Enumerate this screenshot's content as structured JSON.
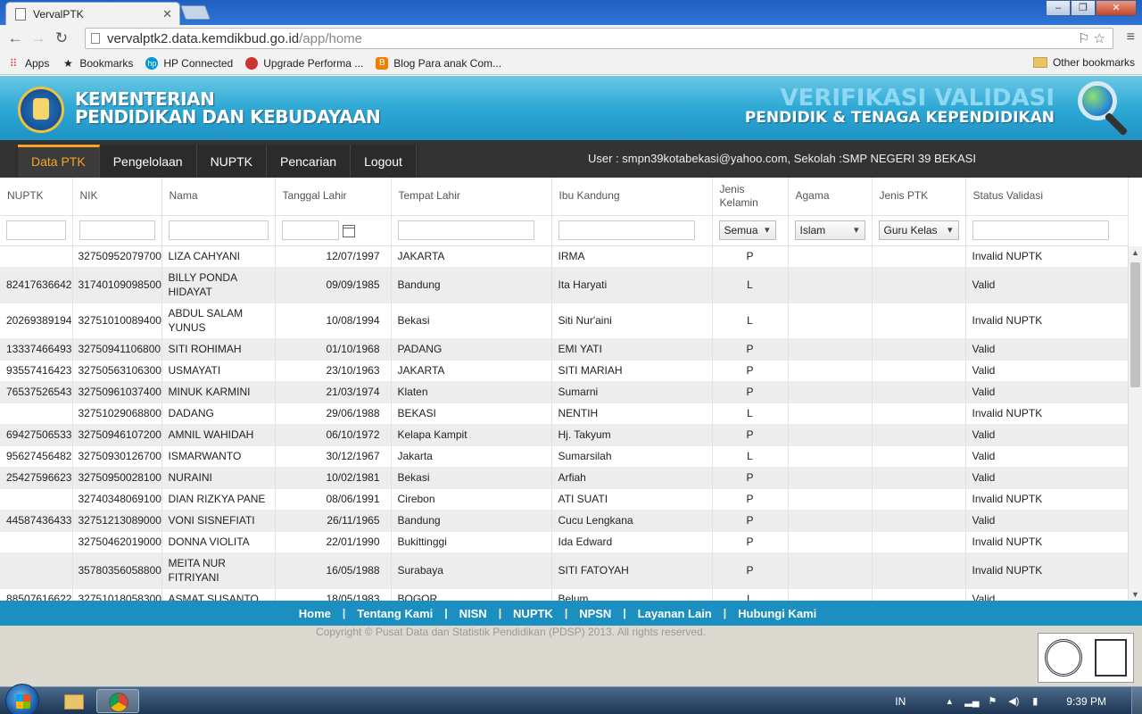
{
  "browser": {
    "tab_title": "VervalPTK",
    "url_host": "vervalptk2.data.kemdikbud.go.id",
    "url_path": "/app/home",
    "bookmarks": [
      {
        "label": "Apps",
        "icon": "apps-grid-icon"
      },
      {
        "label": "Bookmarks",
        "icon": "star-icon"
      },
      {
        "label": "HP Connected",
        "icon": "hp-icon"
      },
      {
        "label": "Upgrade Performa ...",
        "icon": "site-icon"
      },
      {
        "label": "Blog Para anak Com...",
        "icon": "blogger-icon"
      }
    ],
    "other_bookmarks": "Other bookmarks"
  },
  "site": {
    "ministry_line1": "KEMENTERIAN",
    "ministry_line2": "PENDIDIKAN DAN KEBUDAYAAN",
    "app_title_line1": "VERIFIKASI VALIDASI",
    "app_title_line2": "PENDIDIK & TENAGA KEPENDIDIKAN",
    "user_info": "User : smpn39kotabekasi@yahoo.com, Sekolah :SMP NEGERI 39 BEKASI"
  },
  "nav": {
    "items": [
      {
        "label": "Data PTK",
        "active": true
      },
      {
        "label": "Pengelolaan",
        "active": false
      },
      {
        "label": "NUPTK",
        "active": false
      },
      {
        "label": "Pencarian",
        "active": false
      },
      {
        "label": "Logout",
        "active": false
      }
    ]
  },
  "grid": {
    "columns": [
      "NUPTK",
      "NIK",
      "Nama",
      "Tanggal Lahir",
      "Tempat Lahir",
      "Ibu Kandung",
      "Jenis Kelamin",
      "Agama",
      "Jenis PTK",
      "Status Validasi"
    ],
    "filters": {
      "jenis_kelamin": "Semua",
      "agama": "Islam",
      "jenis_ptk": "Guru Kelas"
    },
    "rows": [
      {
        "nuptk": "",
        "nik": "32750952079700",
        "nama": "LIZA CAHYANI",
        "tgl": "12/07/1997",
        "tempat": "JAKARTA",
        "ibu": "IRMA",
        "jk": "P",
        "status": "Invalid NUPTK"
      },
      {
        "nuptk": "82417636642",
        "nik": "31740109098500",
        "nama": "BILLY PONDA HIDAYAT",
        "tgl": "09/09/1985",
        "tempat": "Bandung",
        "ibu": "Ita Haryati",
        "jk": "L",
        "status": "Valid"
      },
      {
        "nuptk": "20269389194",
        "nik": "32751010089400",
        "nama": "ABDUL SALAM YUNUS",
        "tgl": "10/08/1994",
        "tempat": "Bekasi",
        "ibu": "Siti Nur'aini",
        "jk": "L",
        "status": "Invalid NUPTK"
      },
      {
        "nuptk": "13337466493",
        "nik": "32750941106800",
        "nama": "SITI ROHIMAH",
        "tgl": "01/10/1968",
        "tempat": "PADANG",
        "ibu": "EMI YATI",
        "jk": "P",
        "status": "Valid"
      },
      {
        "nuptk": "93557416423",
        "nik": "32750563106300",
        "nama": "USMAYATI",
        "tgl": "23/10/1963",
        "tempat": "JAKARTA",
        "ibu": "SITI MARIAH",
        "jk": "P",
        "status": "Valid"
      },
      {
        "nuptk": "76537526543",
        "nik": "32750961037400",
        "nama": "MINUK KARMINI",
        "tgl": "21/03/1974",
        "tempat": "Klaten",
        "ibu": "Sumarni",
        "jk": "P",
        "status": "Valid"
      },
      {
        "nuptk": "",
        "nik": "32751029068800",
        "nama": "DADANG",
        "tgl": "29/06/1988",
        "tempat": "BEKASI",
        "ibu": "NENTIH",
        "jk": "L",
        "status": "Invalid NUPTK"
      },
      {
        "nuptk": "69427506533",
        "nik": "32750946107200",
        "nama": "AMNIL WAHIDAH",
        "tgl": "06/10/1972",
        "tempat": "Kelapa Kampit",
        "ibu": "Hj. Takyum",
        "jk": "P",
        "status": "Valid"
      },
      {
        "nuptk": "95627456482",
        "nik": "32750930126700",
        "nama": "ISMARWANTO",
        "tgl": "30/12/1967",
        "tempat": "Jakarta",
        "ibu": "Sumarsilah",
        "jk": "L",
        "status": "Valid"
      },
      {
        "nuptk": "25427596623",
        "nik": "32750950028100",
        "nama": "NURAINI",
        "tgl": "10/02/1981",
        "tempat": "Bekasi",
        "ibu": "Arfiah",
        "jk": "P",
        "status": "Valid"
      },
      {
        "nuptk": "",
        "nik": "32740348069100",
        "nama": "DIAN RIZKYA PANE",
        "tgl": "08/06/1991",
        "tempat": "Cirebon",
        "ibu": "ATI SUATI",
        "jk": "P",
        "status": "Invalid NUPTK"
      },
      {
        "nuptk": "44587436433",
        "nik": "32751213089000",
        "nama": "VONI SISNEFIATI",
        "tgl": "26/11/1965",
        "tempat": "Bandung",
        "ibu": "Cucu Lengkana",
        "jk": "P",
        "status": "Valid"
      },
      {
        "nuptk": "",
        "nik": "32750462019000",
        "nama": "DONNA VIOLITA",
        "tgl": "22/01/1990",
        "tempat": "Bukittinggi",
        "ibu": "Ida Edward",
        "jk": "P",
        "status": "Invalid NUPTK"
      },
      {
        "nuptk": "",
        "nik": "35780356058800",
        "nama": "MEITA NUR FITRIYANI",
        "tgl": "16/05/1988",
        "tempat": "Surabaya",
        "ibu": "SITI FATOYAH",
        "jk": "P",
        "status": "Invalid NUPTK"
      },
      {
        "nuptk": "88507616622",
        "nik": "32751018058300",
        "nama": "ASMAT SUSANTO",
        "tgl": "18/05/1983",
        "tempat": "BOGOR",
        "ibu": "Belum",
        "jk": "L",
        "status": "Valid"
      }
    ]
  },
  "footer": {
    "links": [
      "Home",
      "Tentang Kami",
      "NISN",
      "NUPTK",
      "NPSN",
      "Layanan Lain",
      "Hubungi Kami"
    ],
    "copyright": "Copyright © Pusat Data dan Statistik Pendidikan (PDSP) 2013. All rights reserved."
  },
  "taskbar": {
    "lang": "IN",
    "time": "9:39 PM"
  }
}
